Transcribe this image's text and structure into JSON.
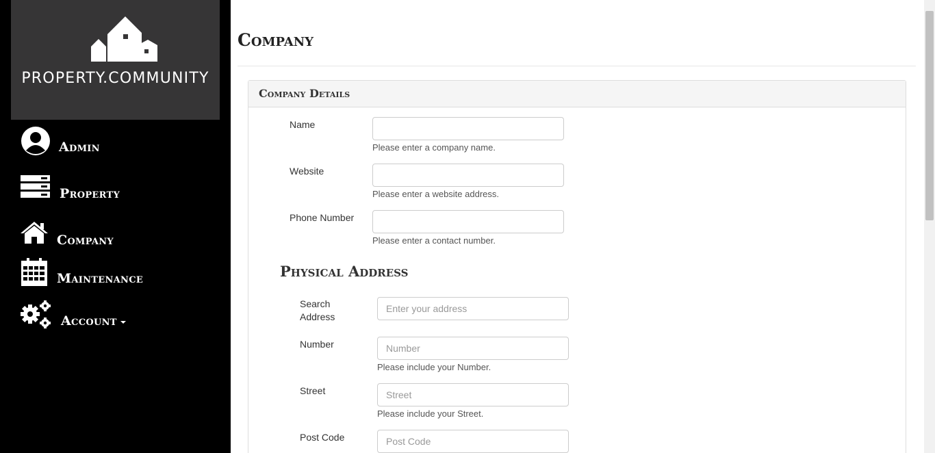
{
  "brand": {
    "name": "PROPERTY.COMMUNITY",
    "logo_icon": "houses-logo-icon"
  },
  "sidebar": {
    "items": [
      {
        "label": "Admin",
        "icon": "user-circle-icon"
      },
      {
        "label": "Property",
        "icon": "server-stack-icon"
      },
      {
        "label": "Company",
        "icon": "home-icon"
      },
      {
        "label": "Maintenance",
        "icon": "calendar-icon"
      },
      {
        "label": "Account",
        "icon": "gears-icon",
        "has_dropdown": true
      }
    ]
  },
  "page": {
    "title": "Company"
  },
  "company_details": {
    "heading": "Company Details",
    "name": {
      "label": "Name",
      "value": "",
      "help": "Please enter a company name."
    },
    "website": {
      "label": "Website",
      "value": "",
      "help": "Please enter a website address."
    },
    "phone": {
      "label": "Phone Number",
      "value": "",
      "help": "Please enter a contact number."
    }
  },
  "physical_address": {
    "heading": "Physical Address",
    "search": {
      "label_line1": "Search",
      "label_line2": "Address",
      "placeholder": "Enter your address"
    },
    "number": {
      "label": "Number",
      "placeholder": "Number",
      "help": "Please include your Number."
    },
    "street": {
      "label": "Street",
      "placeholder": "Street",
      "help": "Please include your Street."
    },
    "postcode": {
      "label": "Post Code",
      "placeholder": "Post Code"
    }
  },
  "colors": {
    "sidebar_bg": "#000000",
    "logo_bg": "#363536",
    "panel_head_bg": "#f5f5f5"
  }
}
